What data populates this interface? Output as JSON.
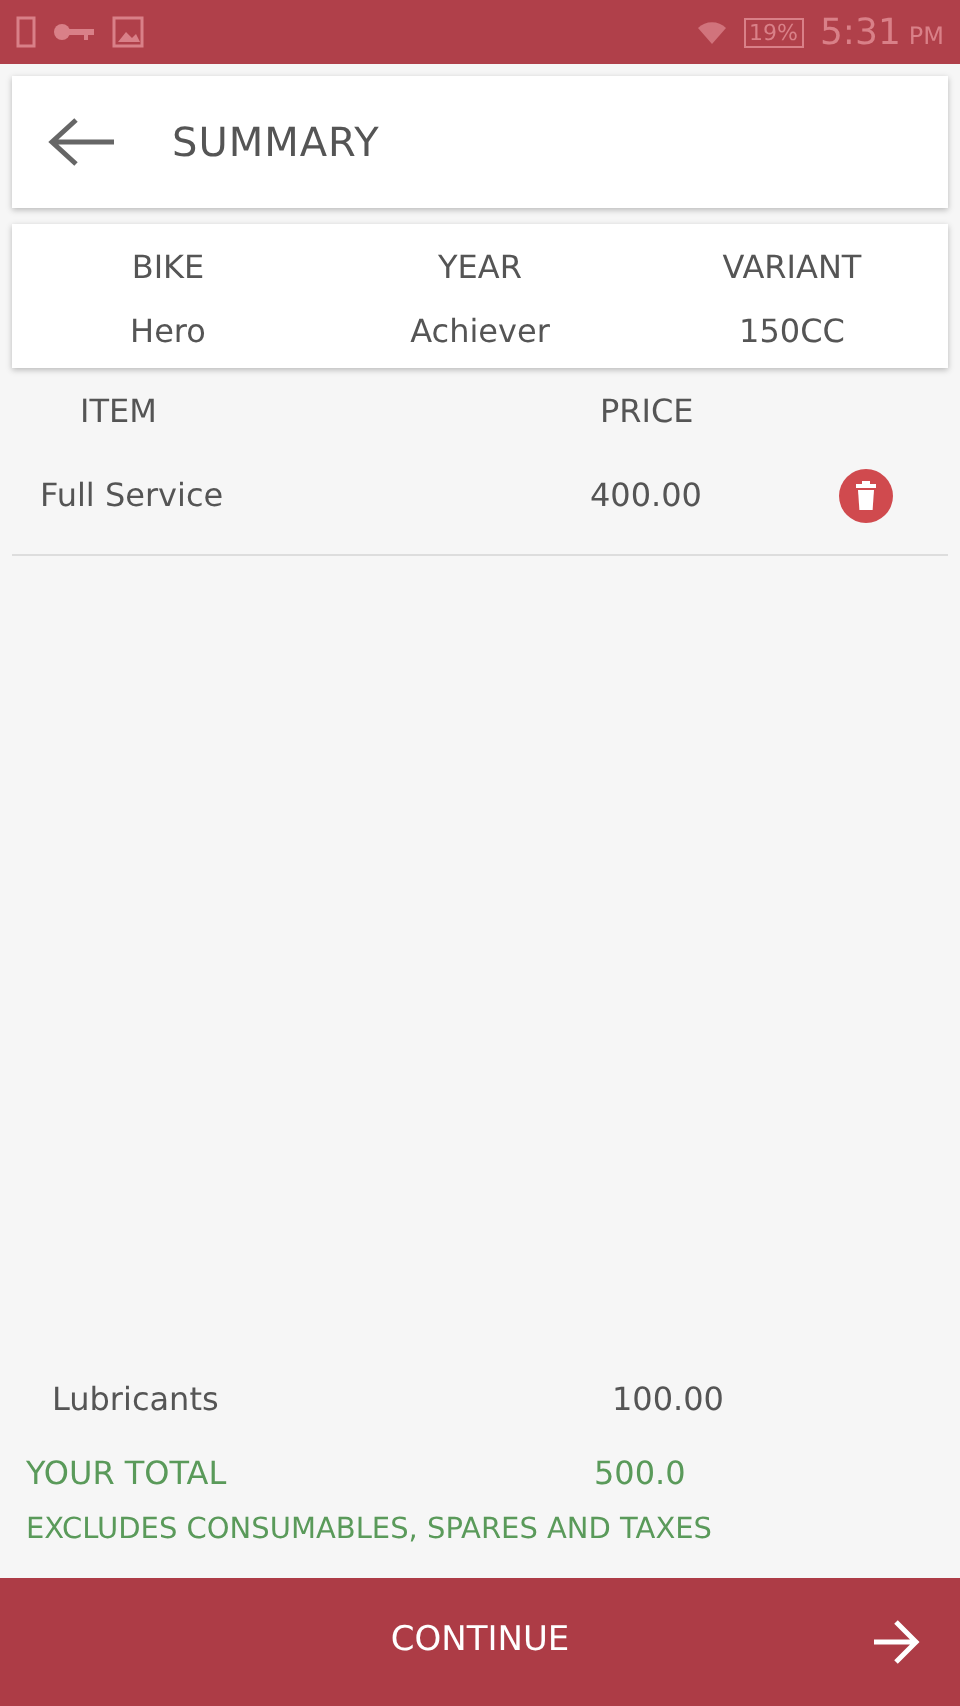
{
  "status_bar": {
    "battery": "19%",
    "time": "5:31",
    "ampm": "PM"
  },
  "header": {
    "title": "SUMMARY"
  },
  "vehicle": {
    "columns": [
      {
        "label": "BIKE",
        "value": "Hero"
      },
      {
        "label": "YEAR",
        "value": "Achiever"
      },
      {
        "label": "VARIANT",
        "value": "150CC"
      }
    ]
  },
  "items_table": {
    "columns": [
      "ITEM",
      "PRICE"
    ],
    "rows": [
      {
        "item": "Full Service",
        "price": "400.00"
      }
    ]
  },
  "extras": [
    {
      "item": "Lubricants",
      "price": "100.00"
    }
  ],
  "total": {
    "label": "YOUR TOTAL",
    "value": "500.0",
    "note": "EXCLUDES CONSUMABLES, SPARES AND TAXES"
  },
  "continue_button": {
    "label": "CONTINUE"
  }
}
